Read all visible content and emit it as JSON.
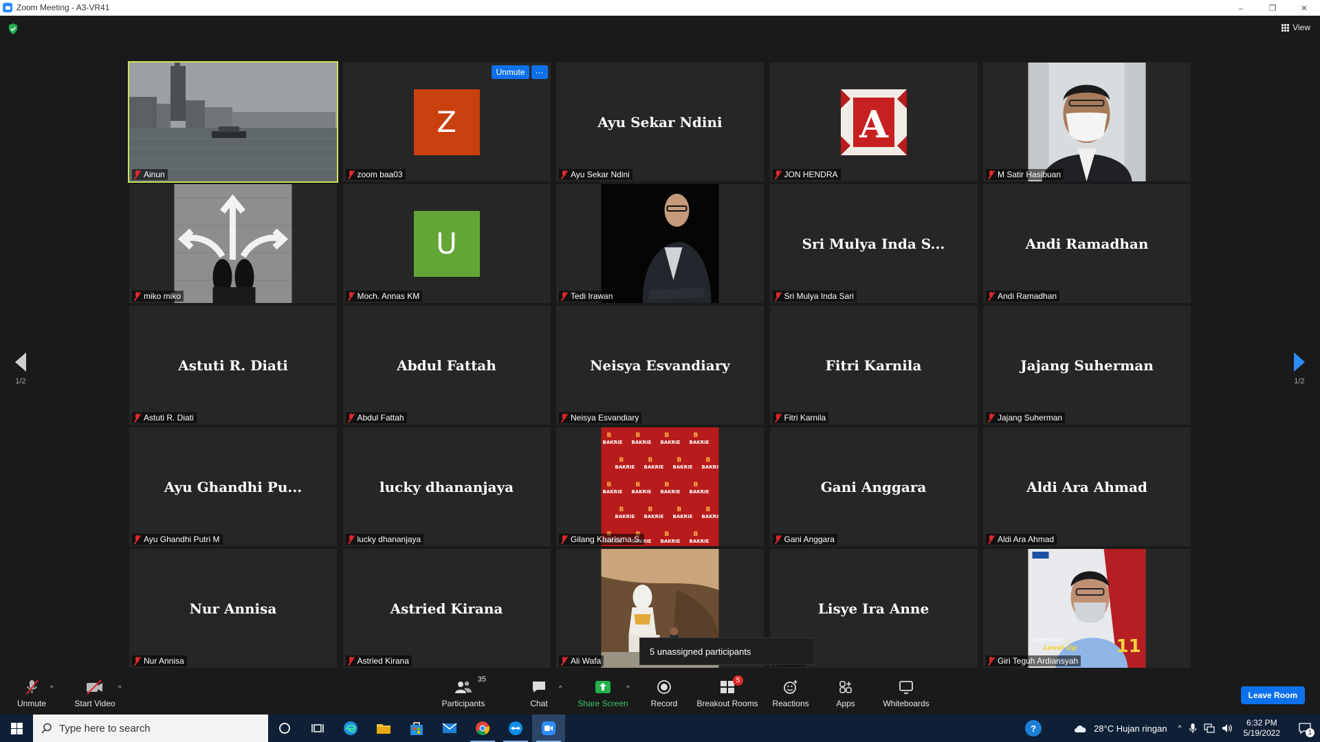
{
  "window": {
    "title": "Zoom Meeting - A3-VR41",
    "minimize": "–",
    "restore": "❐",
    "close": "✕"
  },
  "meeting": {
    "view_label": "View",
    "page_left": "1/2",
    "page_right": "1/2",
    "tooltip": "5 unassigned participants",
    "tile_controls": {
      "unmute": "Unmute",
      "more": "···"
    },
    "tiles": [
      {
        "big": "",
        "label": "Ainun",
        "kind": "photo-harbor"
      },
      {
        "big": "",
        "label": "zoom baa03",
        "kind": "avatar",
        "initial": "Z",
        "color": "#c9400f"
      },
      {
        "big": "Ayu Sekar Ndini",
        "label": "Ayu Sekar Ndini",
        "kind": "name"
      },
      {
        "big": "",
        "label": "JON HENDRA",
        "kind": "photo-letter"
      },
      {
        "big": "",
        "label": "M Satir Hasibuan",
        "kind": "photo-person-mask"
      },
      {
        "big": "",
        "label": "miko miko",
        "kind": "photo-arrows"
      },
      {
        "big": "",
        "label": "Moch. Annas KM",
        "kind": "avatar",
        "initial": "U",
        "color": "#62a636"
      },
      {
        "big": "",
        "label": "Tedi Irawan",
        "kind": "photo-person-dark"
      },
      {
        "big": "Sri Mulya Inda S...",
        "label": "Sri Mulya Inda Sari",
        "kind": "name"
      },
      {
        "big": "Andi Ramadhan",
        "label": "Andi Ramadhan",
        "kind": "name"
      },
      {
        "big": "Astuti R. Diati",
        "label": "Astuti R. Diati",
        "kind": "name"
      },
      {
        "big": "Abdul Fattah",
        "label": "Abdul Fattah",
        "kind": "name"
      },
      {
        "big": "Neisya Esvandiary",
        "label": "Neisya Esvandiary",
        "kind": "name"
      },
      {
        "big": "Fitri Karnila",
        "label": "Fitri Karnila",
        "kind": "name"
      },
      {
        "big": "Jajang Suherman",
        "label": "Jajang Suherman",
        "kind": "name"
      },
      {
        "big": "Ayu Ghandhi Pu...",
        "label": "Ayu Ghandhi Putri M",
        "kind": "name"
      },
      {
        "big": "lucky dhananjaya",
        "label": "lucky dhananjaya",
        "kind": "name"
      },
      {
        "big": "",
        "label": "Gilang Kharisma S.",
        "kind": "photo-bakrie"
      },
      {
        "big": "Gani Anggara",
        "label": "Gani Anggara",
        "kind": "name"
      },
      {
        "big": "Aldi Ara Ahmad",
        "label": "Aldi Ara Ahmad",
        "kind": "name"
      },
      {
        "big": "Nur Annisa",
        "label": "Nur Annisa",
        "kind": "name"
      },
      {
        "big": "Astried Kirana",
        "label": "Astried Kirana",
        "kind": "name"
      },
      {
        "big": "",
        "label": "Ali Wafa",
        "kind": "photo-statue"
      },
      {
        "big": "Lisye Ira Anne",
        "label": "Anne",
        "kind": "name"
      },
      {
        "big": "",
        "label": "Giri Teguh Ardiansyah",
        "kind": "photo-person-bakrie"
      }
    ],
    "bakrie_text": "BAKRIE",
    "bakrie_logo_letter": "B",
    "letter_a": "A",
    "poster_text_1": "Celebration",
    "poster_text_2": "Level Up",
    "poster_number": "11"
  },
  "toolbar": {
    "unmute": "Unmute",
    "start_video": "Start Video",
    "participants": "Participants",
    "participants_count": "35",
    "chat": "Chat",
    "share_screen": "Share Screen",
    "record": "Record",
    "breakout_rooms": "Breakout Rooms",
    "breakout_badge": "5",
    "reactions": "Reactions",
    "apps": "Apps",
    "whiteboards": "Whiteboards",
    "leave_room": "Leave Room",
    "caret": "^"
  },
  "taskbar": {
    "search_placeholder": "Type here to search",
    "weather": "28°C  Hujan ringan",
    "time": "6:32 PM",
    "date": "5/19/2022",
    "notification_count": "1",
    "help": "?",
    "caret": "^"
  },
  "colors": {
    "accent_blue": "#0e71eb",
    "active_speaker_border": "#c9e45a",
    "mute_red": "#e02828",
    "share_green": "#3cc56b"
  }
}
